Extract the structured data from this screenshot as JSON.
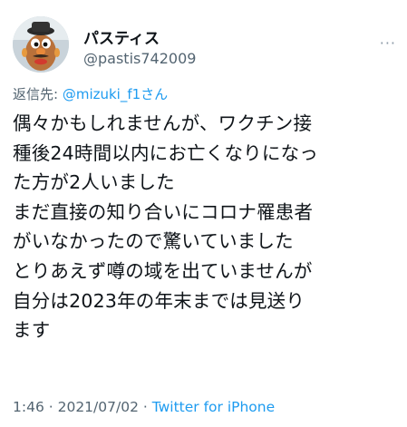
{
  "user": {
    "display_name": "パスティス",
    "handle": "@pastis742009"
  },
  "menu": {
    "more_label": "···"
  },
  "reply": {
    "prefix": "返信先: ",
    "mention": "@mizuki_f1さん"
  },
  "tweet": {
    "lines": [
      "偶々かもしれませんが、ワクチン接",
      "種後24時間以内にお亡くなりになっ",
      "た方が2人いました",
      "まだ直接の知り合いにコロナ罹患者",
      "がいなかったので驚いていました",
      "とりあえず噂の域を出ていませんが",
      "自分は2023年の年末までは見送り",
      "ます"
    ]
  },
  "meta": {
    "time": "1:46",
    "separator1": " · ",
    "date": "2021/07/02",
    "separator2": " · ",
    "source": "Twitter for iPhone"
  },
  "colors": {
    "accent": "#1d9bf0",
    "secondary_text": "#536471",
    "primary_text": "#0f1419"
  },
  "icons": {
    "avatar": "potato-head-avatar",
    "more": "more-dots-icon"
  }
}
